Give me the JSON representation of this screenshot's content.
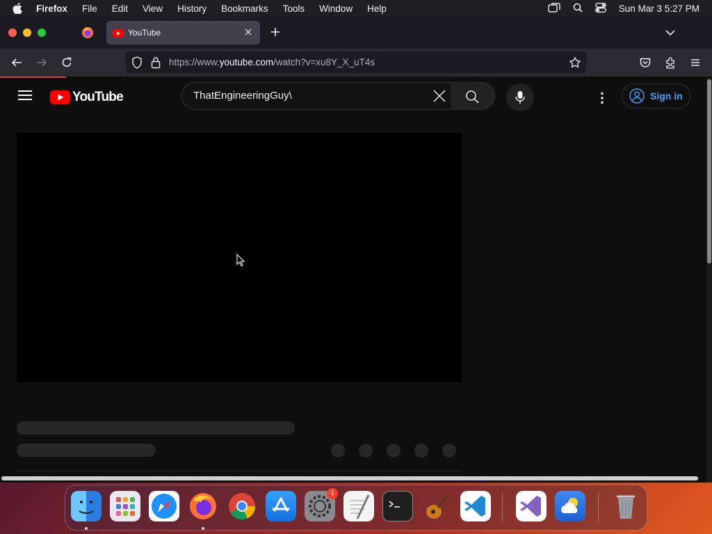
{
  "menubar": {
    "app": "Firefox",
    "items": [
      "File",
      "Edit",
      "View",
      "History",
      "Bookmarks",
      "Tools",
      "Window",
      "Help"
    ],
    "clock": "Sun Mar 3  5:27 PM"
  },
  "browser": {
    "tab_title": "YouTube",
    "url_prefix": "https://www.",
    "url_host": "youtube.com",
    "url_path": "/watch?v=xu8Y_X_uT4s"
  },
  "youtube": {
    "logo_text": "YouTube",
    "search_query": "ThatEngineeringGuy\\",
    "signin_label": "Sign in"
  },
  "dock": {
    "apps": [
      "finder-icon",
      "launchpad-icon",
      "safari-icon",
      "firefox-icon",
      "chrome-icon",
      "app-store-icon",
      "system-settings-icon",
      "textedit-icon",
      "terminal-icon",
      "garageband-icon",
      "vscode-icon",
      "visual-studio-icon",
      "weather-icon",
      "trash-icon"
    ],
    "settings_badge": "1"
  },
  "colors": {
    "yt_red": "#ff0000",
    "signin_blue": "#3ea6ff",
    "page_bg": "#0f0f0f"
  }
}
